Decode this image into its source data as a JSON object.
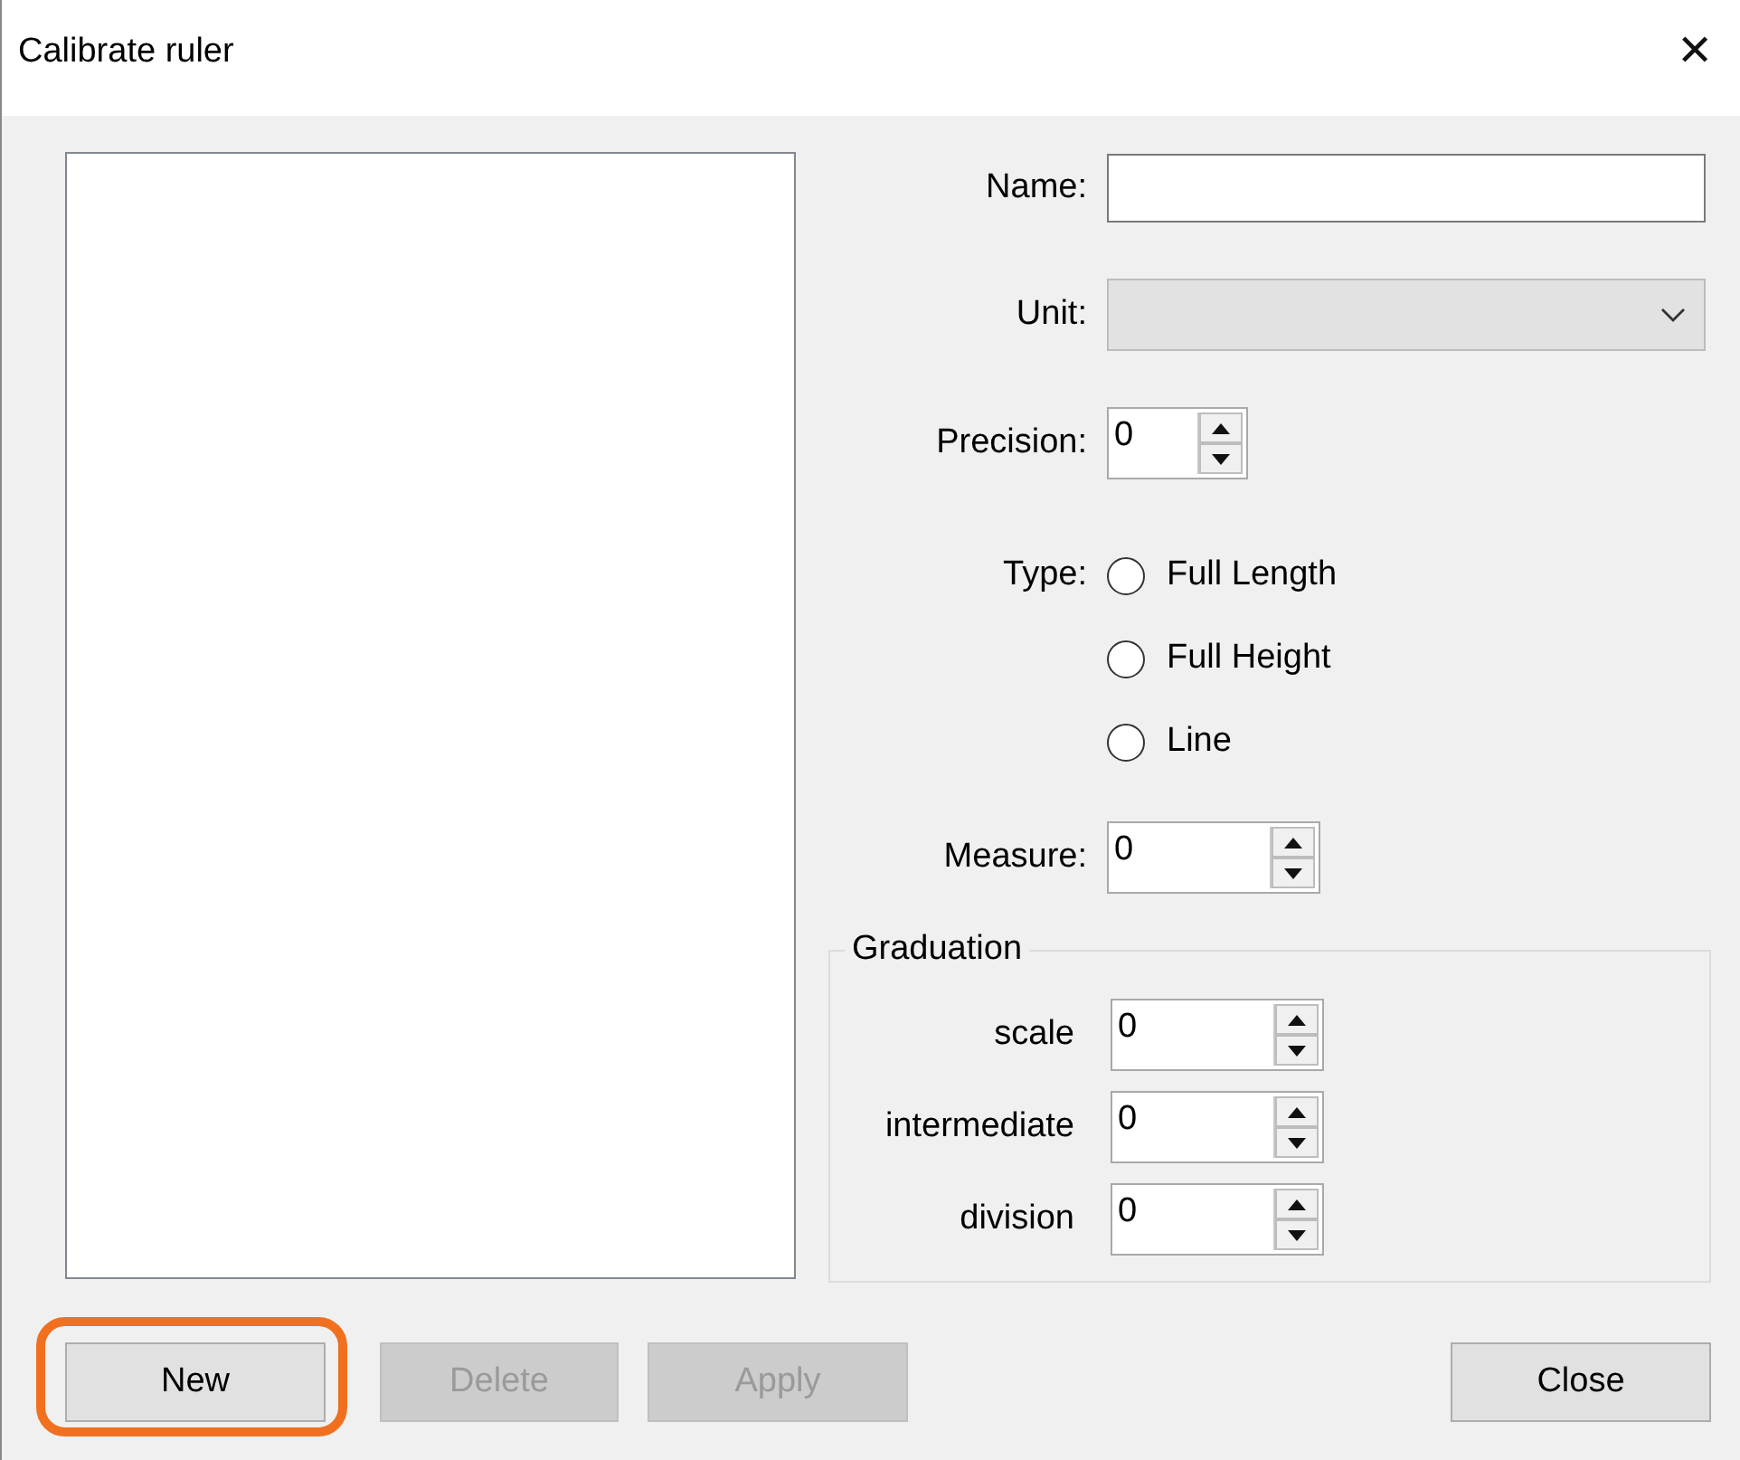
{
  "window": {
    "title": "Calibrate ruler",
    "close_glyph": "✕"
  },
  "form": [
    {
      "kind": "text",
      "label": "Name:"
    },
    {
      "kind": "dropdown",
      "label": "Unit:",
      "disabled": true
    },
    {
      "kind": "spinner",
      "label": "Precision:",
      "value": "0"
    },
    {
      "kind": "radio",
      "label": "Type:",
      "options": [
        {
          "label": "Full Length",
          "selected": false
        },
        {
          "label": "Full Height",
          "selected": false
        },
        {
          "label": "Line",
          "selected": false
        }
      ]
    },
    {
      "kind": "spinner",
      "label": "Measure:",
      "value": "0"
    }
  ],
  "graduation": {
    "title": "Graduation",
    "fields": [
      {
        "label": "scale",
        "value": "0"
      },
      {
        "label": "intermediate",
        "value": "0"
      },
      {
        "label": "division",
        "value": "0"
      }
    ]
  },
  "buttons": [
    {
      "label": "New",
      "disabled": false,
      "highlighted": true
    },
    {
      "label": "Delete",
      "disabled": true,
      "highlighted": false
    },
    {
      "label": "Apply",
      "disabled": true,
      "highlighted": false
    },
    {
      "label": "Close",
      "disabled": false,
      "highlighted": false
    }
  ]
}
